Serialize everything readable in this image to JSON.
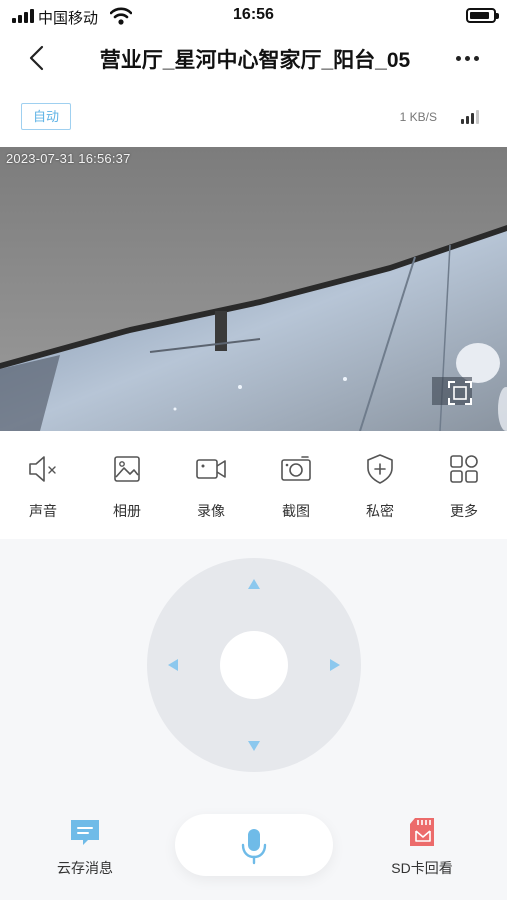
{
  "status_bar": {
    "carrier": "中国移动",
    "time": "16:56"
  },
  "nav": {
    "title": "营业厅_星河中心智家厅_阳台_05",
    "back_icon": "chevron-left-icon",
    "more_icon": "more-dots-icon"
  },
  "info": {
    "quality_label": "自动",
    "speed": "1 KB/S",
    "signal_icon": "network-signal-icon"
  },
  "video": {
    "timestamp": "2023-07-31 16:56:37",
    "fullscreen_icon": "fullscreen-icon"
  },
  "tools": [
    {
      "label": "声音",
      "icon": "speaker-muted-icon"
    },
    {
      "label": "相册",
      "icon": "album-icon"
    },
    {
      "label": "录像",
      "icon": "video-record-icon"
    },
    {
      "label": "截图",
      "icon": "camera-snapshot-icon"
    },
    {
      "label": "私密",
      "icon": "shield-privacy-icon"
    },
    {
      "label": "更多",
      "icon": "grid-more-icon"
    }
  ],
  "ptz": {
    "arrows": [
      "up",
      "right",
      "down",
      "left"
    ]
  },
  "bottom": {
    "cloud_label": "云存消息",
    "sd_label": "SD卡回看",
    "mic_icon": "microphone-icon"
  },
  "colors": {
    "accent": "#5fb3e6",
    "arrow": "#8cc8ee",
    "sd_red": "#ec6b6b"
  }
}
